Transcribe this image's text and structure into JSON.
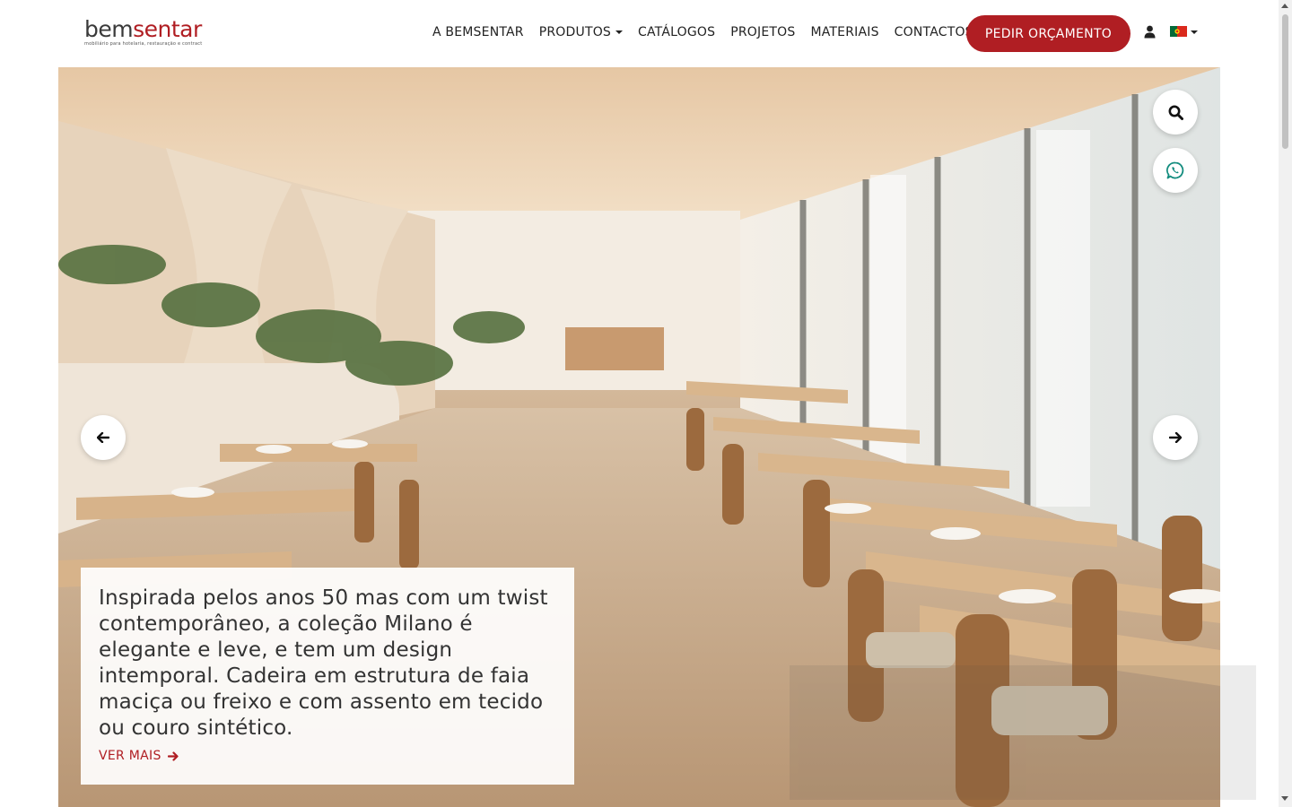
{
  "header": {
    "logo": {
      "word_dark": "bem",
      "word_accent": "sentar",
      "tagline": "mobiliário para hotelaria, restauração e contract"
    },
    "nav": [
      {
        "label": "A BEMSENTAR",
        "dropdown": false
      },
      {
        "label": "PRODUTOS",
        "dropdown": true
      },
      {
        "label": "CATÁLOGOS",
        "dropdown": false
      },
      {
        "label": "PROJETOS",
        "dropdown": false
      },
      {
        "label": "MATERIAIS",
        "dropdown": false
      },
      {
        "label": "CONTACTOS",
        "dropdown": false
      }
    ],
    "cta_label": "PEDIR ORÇAMENTO",
    "user_icon": "user-icon",
    "language_flag": "portugal-flag-icon"
  },
  "hero": {
    "caption": "Inspirada pelos anos 50 mas com um twist contemporâneo, a coleção Milano é elegante e leve, e tem um design intemporal. Cadeira em estrutura de faia maciça ou freixo e com assento em tecido ou couro sintético.",
    "link_label": "VER MAIS",
    "prev_icon": "arrow-left-icon",
    "next_icon": "arrow-right-icon",
    "search_icon": "search-icon",
    "whatsapp_icon": "whatsapp-icon"
  },
  "colors": {
    "brand_red": "#b01e23",
    "text_dark": "#222222",
    "whatsapp_green": "#128c7e"
  }
}
